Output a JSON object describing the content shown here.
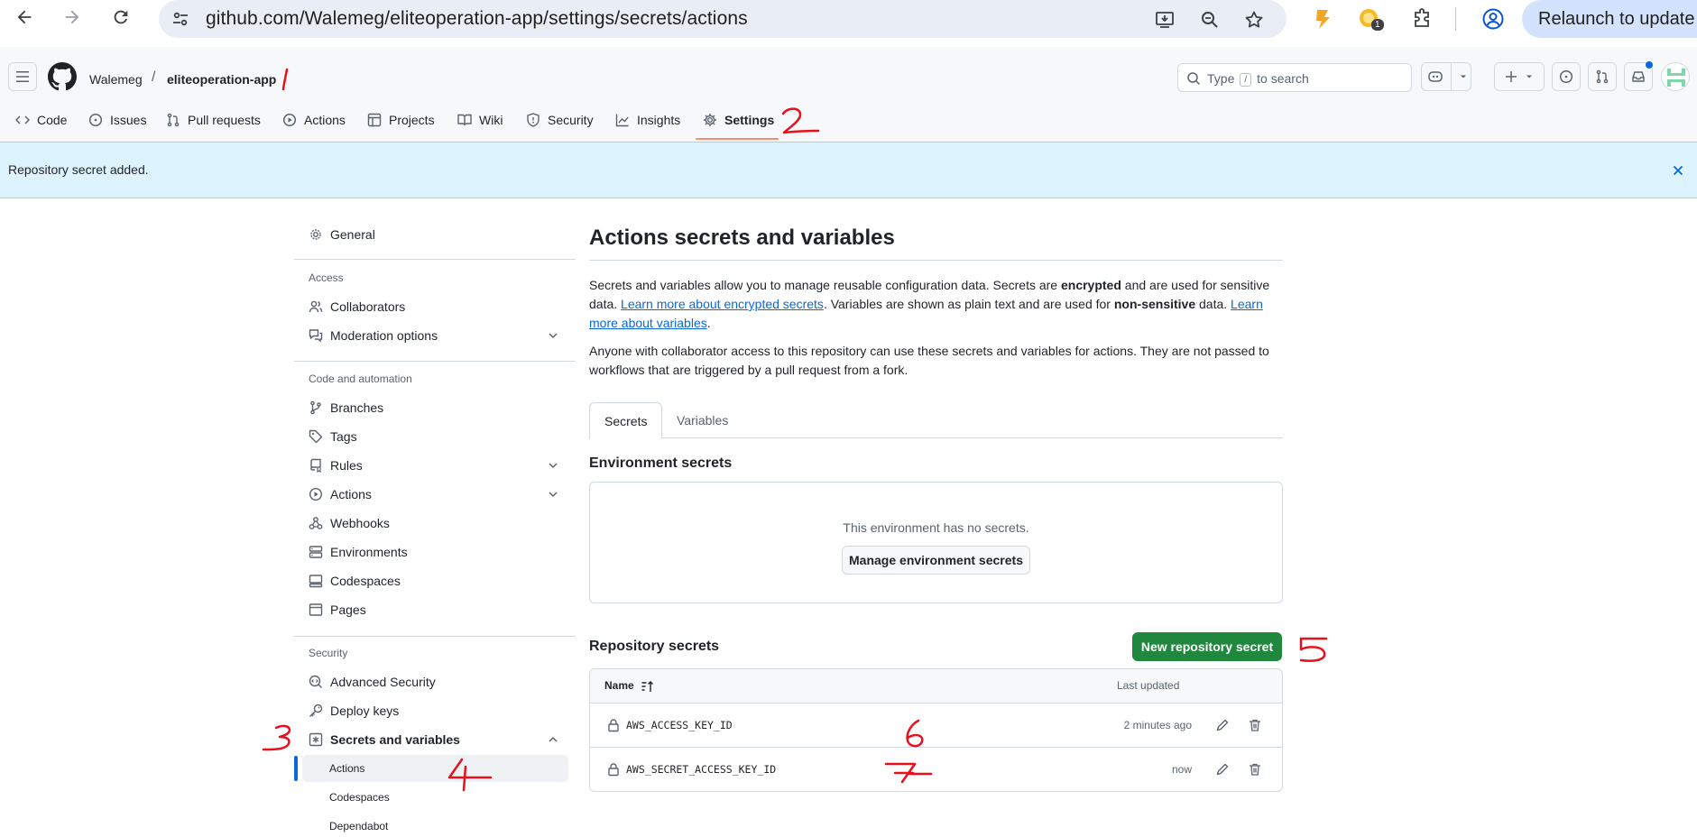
{
  "browser": {
    "url": "github.com/Walemeg/eliteoperation-app/settings/secrets/actions",
    "extension_badge": "1",
    "relaunch_label": "Relaunch to update"
  },
  "header": {
    "owner": "Walemeg",
    "separator": "/",
    "repo": "eliteoperation-app",
    "search_placeholder_pre": "Type",
    "search_key": "/",
    "search_placeholder_post": "to search"
  },
  "repo_tabs": [
    {
      "label": "Code",
      "icon": "code-icon"
    },
    {
      "label": "Issues",
      "icon": "issue-icon"
    },
    {
      "label": "Pull requests",
      "icon": "pull-request-icon"
    },
    {
      "label": "Actions",
      "icon": "play-icon"
    },
    {
      "label": "Projects",
      "icon": "table-icon"
    },
    {
      "label": "Wiki",
      "icon": "book-icon"
    },
    {
      "label": "Security",
      "icon": "shield-icon"
    },
    {
      "label": "Insights",
      "icon": "graph-icon"
    },
    {
      "label": "Settings",
      "icon": "gear-icon"
    }
  ],
  "flash": {
    "message": "Repository secret added."
  },
  "sidebar": {
    "general": "General",
    "access_heading": "Access",
    "collaborators": "Collaborators",
    "moderation": "Moderation options",
    "code_heading": "Code and automation",
    "branches": "Branches",
    "tags": "Tags",
    "rules": "Rules",
    "actions": "Actions",
    "webhooks": "Webhooks",
    "environments": "Environments",
    "codespaces": "Codespaces",
    "pages": "Pages",
    "security_heading": "Security",
    "advanced_security": "Advanced Security",
    "deploy_keys": "Deploy keys",
    "secrets_and_variables": "Secrets and variables",
    "sub_actions": "Actions",
    "sub_codespaces": "Codespaces",
    "sub_dependabot": "Dependabot"
  },
  "main": {
    "title": "Actions secrets and variables",
    "intro_1": "Secrets and variables allow you to manage reusable configuration data. Secrets are ",
    "intro_encrypted": "encrypted",
    "intro_2": " and are used for sensitive data. ",
    "intro_link_secrets": "Learn more about encrypted secrets",
    "intro_3": ". Variables are shown as plain text and are used for ",
    "intro_nonsensitive": "non-sensitive",
    "intro_4": " data. ",
    "intro_link_vars": "Learn more about variables",
    "intro_5": ".",
    "access_note": "Anyone with collaborator access to this repository can use these secrets and variables for actions. They are not passed to workflows that are triggered by a pull request from a fork.",
    "tab_secrets": "Secrets",
    "tab_variables": "Variables",
    "env_heading": "Environment secrets",
    "env_empty": "This environment has no secrets.",
    "manage_env_button": "Manage environment secrets",
    "repo_heading": "Repository secrets",
    "new_secret_button": "New repository secret",
    "col_name": "Name",
    "col_updated": "Last updated",
    "secrets": [
      {
        "name": "AWS_ACCESS_KEY_ID",
        "updated": "2 minutes ago"
      },
      {
        "name": "AWS_SECRET_ACCESS_KEY_ID",
        "updated": "now"
      }
    ]
  },
  "annotations": [
    "1",
    "2",
    "3",
    "4",
    "5",
    "6",
    "7"
  ],
  "colors": {
    "accent": "#0969da",
    "primary_button": "#1f883d",
    "flash_bg": "#ddf4ff",
    "annotation": "#e8101c"
  }
}
